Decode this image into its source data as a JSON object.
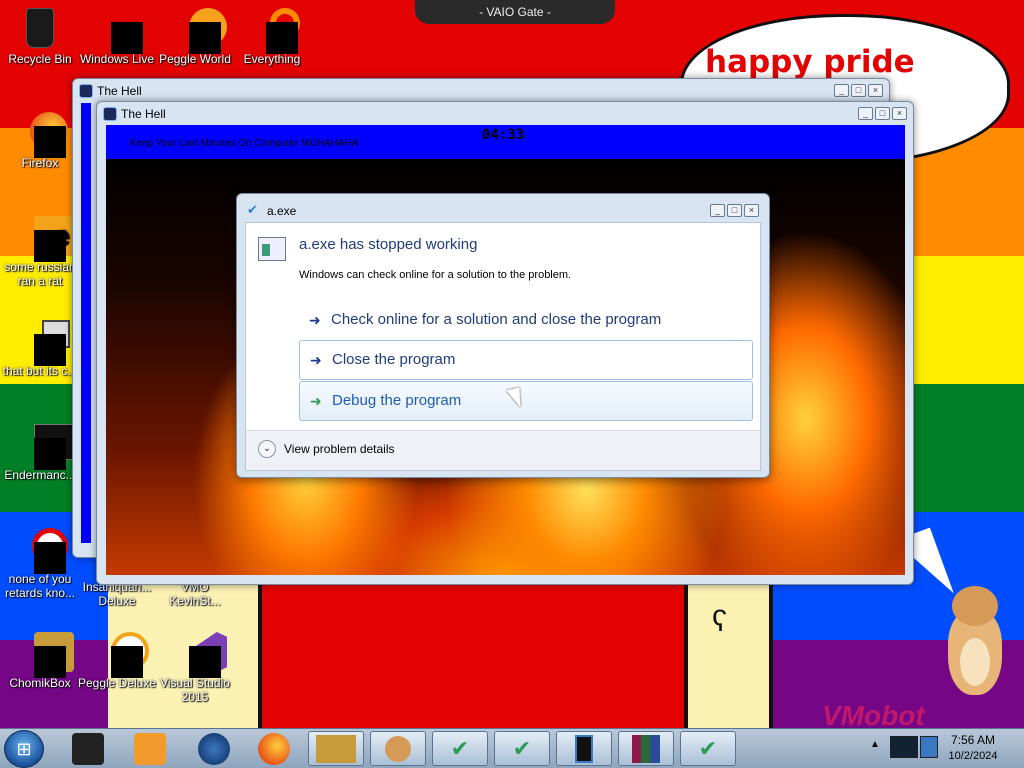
{
  "system": {
    "title_bar": "- VAIO Gate -"
  },
  "wallpaper": {
    "bubble_text": "happy pride month",
    "watermark": "VMobot",
    "colors": [
      "#e40303",
      "#ff8c00",
      "#ffed00",
      "#008026",
      "#004dff",
      "#750787"
    ]
  },
  "desktop_icons": [
    {
      "label": "Recycle Bin",
      "icon": "recycle-bin-icon"
    },
    {
      "label": "Windows Live",
      "icon": "windows-live-icon"
    },
    {
      "label": "Peggle World",
      "icon": "peggle-icon"
    },
    {
      "label": "Everything",
      "icon": "everything-icon"
    },
    {
      "label": "Firefox",
      "icon": "firefox-icon"
    },
    {
      "label": "some russian ran a rat",
      "icon": "file-icon"
    },
    {
      "label": "that but its c...",
      "icon": "shortcut-icon"
    },
    {
      "label": "Endermanc...",
      "icon": "app-icon"
    },
    {
      "label": "none of you retards kno...",
      "icon": "app-icon"
    },
    {
      "label": "Insaniquari... Deluxe",
      "icon": "game-icon"
    },
    {
      "label": "VMO KevinSt...",
      "icon": "app-icon"
    },
    {
      "label": "ChomikBox",
      "icon": "chomikbox-icon"
    },
    {
      "label": "Peggle Deluxe",
      "icon": "peggle-icon"
    },
    {
      "label": "Visual Studio 2015",
      "icon": "visual-studio-icon"
    }
  ],
  "hell_back": {
    "title": "The Hell"
  },
  "hell_front": {
    "title": "The Hell",
    "banner_text": "Keep Your Last Minutes On Computer MUHAHAHA",
    "timer": "04:33"
  },
  "dialog": {
    "title": "a.exe",
    "main_instruction": "a.exe has stopped working",
    "sub_instruction": "Windows can check online for a solution to the problem.",
    "commands": [
      "Check online for a solution and close the program",
      "Close the program",
      "Debug the program"
    ],
    "details_label": "View problem details"
  },
  "taskbar": {
    "time": "7:56 AM",
    "date": "10/2/2024"
  }
}
